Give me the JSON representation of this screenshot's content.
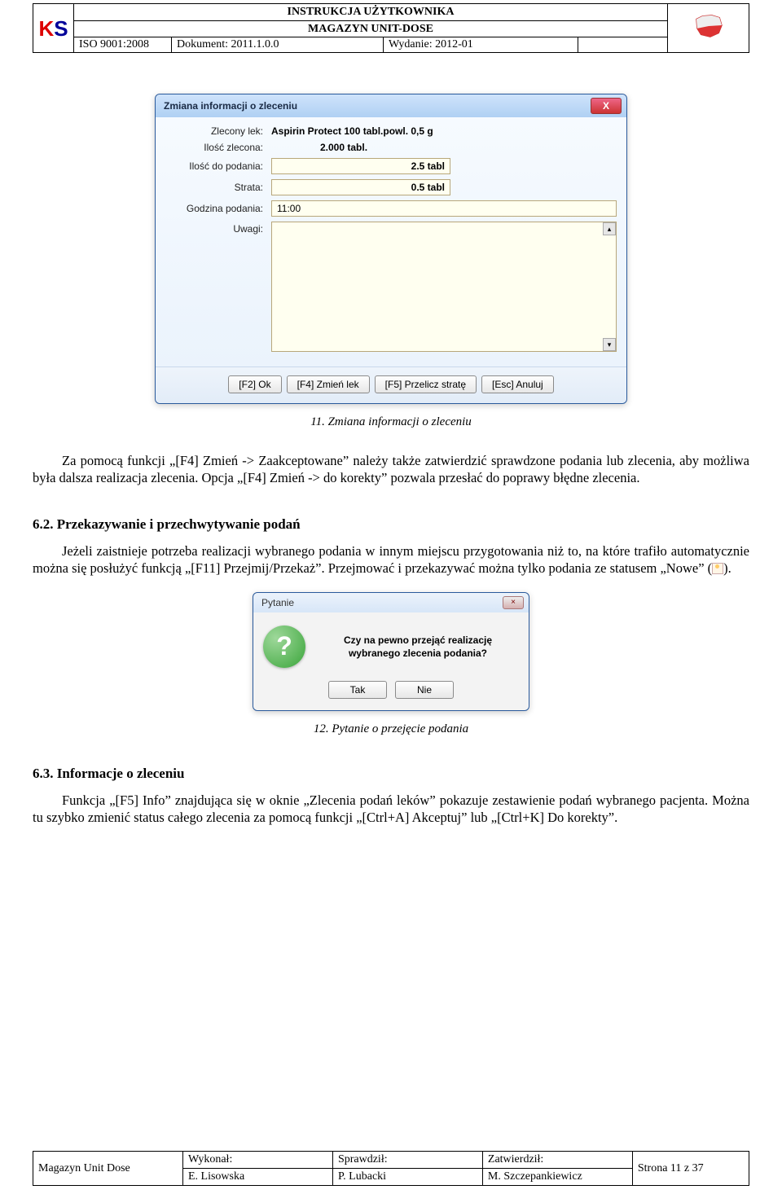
{
  "header": {
    "title1": "INSTRUKCJA UŻYTKOWNIKA",
    "title2": "MAGAZYN UNIT-DOSE",
    "iso": "ISO 9001:2008",
    "doc": "Dokument: 2011.1.0.0",
    "issue": "Wydanie: 2012-01"
  },
  "dialog1": {
    "title": "Zmiana informacji o zleceniu",
    "labels": {
      "zlecony": "Zlecony lek:",
      "ilosc_zlec": "Ilość zlecona:",
      "ilosc_pod": "Ilość do podania:",
      "strata": "Strata:",
      "godzina": "Godzina podania:",
      "uwagi": "Uwagi:"
    },
    "values": {
      "zlecony": "Aspirin Protect 100 tabl.powl. 0,5 g",
      "ilosc_zlec": "2.000 tabl.",
      "ilosc_pod": "2.5 tabl",
      "strata": "0.5 tabl",
      "godzina": "11:00"
    },
    "buttons": {
      "ok": "[F2] Ok",
      "zmien": "[F4] Zmień lek",
      "przelicz": "[F5] Przelicz stratę",
      "anuluj": "[Esc] Anuluj"
    }
  },
  "caption1": "11. Zmiana informacji o zleceniu",
  "para1": "Za pomocą funkcji „[F4] Zmień -> Zaakceptowane” należy także zatwierdzić sprawdzone podania lub zlecenia, aby możliwa była dalsza realizacja zlecenia. Opcja „[F4] Zmień -> do korekty” pozwala przesłać do poprawy błędne zlecenia.",
  "heading62": "6.2.   Przekazywanie i przechwytywanie podań",
  "para2a": "Jeżeli zaistnieje potrzeba realizacji wybranego podania w innym miejscu przygotowania niż to, na które trafiło automatycznie można się posłużyć funkcją „[F11] Przejmij/Przekaż”. Przejmować i przekazywać można tylko podania ze statusem „Nowe” (",
  "para2b": ").",
  "dialog2": {
    "title": "Pytanie",
    "message": "Czy na pewno przejąć realizację wybranego zlecenia podania?",
    "yes": "Tak",
    "no": "Nie"
  },
  "caption2": "12. Pytanie o przejęcie podania",
  "heading63": "6.3.   Informacje o zleceniu",
  "para3": "Funkcja „[F5] Info” znajdująca się w oknie „Zlecenia podań leków” pokazuje zestawienie podań wybranego pacjenta. Można tu szybko zmienić status całego zlecenia za pomocą funkcji „[Ctrl+A] Akceptuj” lub „[Ctrl+K] Do korekty”.",
  "footer": {
    "left": "Magazyn Unit Dose",
    "wykonal_h": "Wykonał:",
    "wykonal_v": "E. Lisowska",
    "sprawdzil_h": "Sprawdził:",
    "sprawdzil_v": "P. Lubacki",
    "zatwierdzil_h": "Zatwierdził:",
    "zatwierdzil_v": "M. Szczepankiewicz",
    "page": "Strona 11 z 37"
  }
}
